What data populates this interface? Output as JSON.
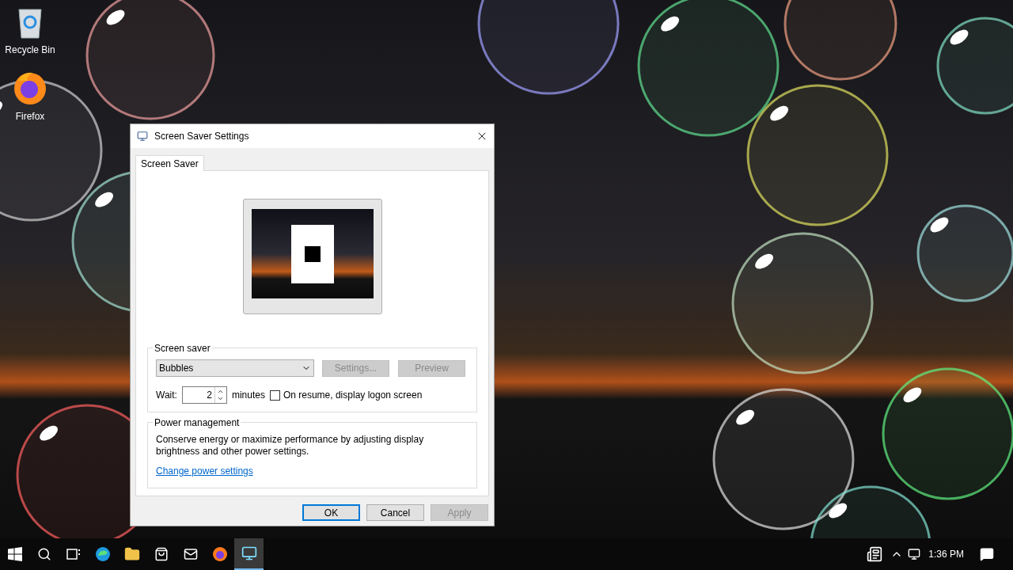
{
  "desktop_icons": [
    {
      "label": "Recycle Bin",
      "kind": "recycle"
    },
    {
      "label": "Firefox",
      "kind": "firefox"
    }
  ],
  "dialog": {
    "title": "Screen Saver Settings",
    "tabs": [
      {
        "label": "Screen Saver",
        "selected": true
      }
    ],
    "screen_saver": {
      "legend": "Screen saver",
      "selection": "Bubbles",
      "settings_button": {
        "label": "Settings...",
        "disabled": true
      },
      "preview_button": {
        "label": "Preview",
        "disabled": true
      },
      "wait_label": "Wait:",
      "wait_value": "2",
      "minutes_label": "minutes",
      "logon_checkbox": {
        "label": "On resume, display logon screen",
        "checked": false
      }
    },
    "power": {
      "legend": "Power management",
      "text": "Conserve energy or maximize performance by adjusting display brightness and other power settings.",
      "link": "Change power settings"
    },
    "buttons": [
      {
        "label": "OK",
        "default": true,
        "disabled": false
      },
      {
        "label": "Cancel",
        "default": false,
        "disabled": false
      },
      {
        "label": "Apply",
        "default": false,
        "disabled": true
      }
    ]
  },
  "taskbar": {
    "apps": [
      {
        "kind": "start",
        "active": false
      },
      {
        "kind": "search",
        "active": false
      },
      {
        "kind": "taskview",
        "active": false
      },
      {
        "kind": "edge",
        "active": false
      },
      {
        "kind": "folder",
        "active": false
      },
      {
        "kind": "store",
        "active": false
      },
      {
        "kind": "mail",
        "active": false
      },
      {
        "kind": "firefox",
        "active": false
      },
      {
        "kind": "display",
        "active": true
      }
    ],
    "clock": "1:36 PM"
  }
}
